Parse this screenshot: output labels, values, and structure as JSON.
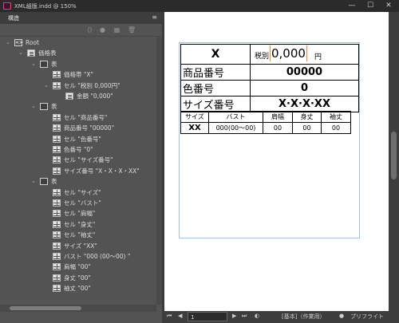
{
  "window": {
    "title": "XML組版.indd @ 150%",
    "minimize": "—",
    "maximize": "☐",
    "close": "✕"
  },
  "panel": {
    "tab_label": "構造",
    "menu_icon": "hamburger-icon",
    "toolbar_icons": [
      "tag-icon",
      "circle-icon",
      "new-element-icon",
      "delete-icon"
    ]
  },
  "tree": [
    {
      "level": 0,
      "twisty": "⌄",
      "icon": "root",
      "label": "Root"
    },
    {
      "level": 1,
      "twisty": "⌄",
      "icon": "doc",
      "label": "価格表"
    },
    {
      "level": 2,
      "twisty": "⌄",
      "icon": "table",
      "label": "表"
    },
    {
      "level": 3,
      "twisty": "",
      "icon": "cell",
      "label": "価格帯 \"X\""
    },
    {
      "level": 3,
      "twisty": "⌄",
      "icon": "cell",
      "label": "セル \"税別 0,000円\""
    },
    {
      "level": 4,
      "twisty": "",
      "icon": "doc",
      "label": "金額 \"0,000\""
    },
    {
      "level": 2,
      "twisty": "⌄",
      "icon": "table",
      "label": "表"
    },
    {
      "level": 3,
      "twisty": "",
      "icon": "cell",
      "label": "セル \"商品番号\""
    },
    {
      "level": 3,
      "twisty": "",
      "icon": "cell",
      "label": "商品番号 \"00000\""
    },
    {
      "level": 3,
      "twisty": "",
      "icon": "cell",
      "label": "セル \"色番号\""
    },
    {
      "level": 3,
      "twisty": "",
      "icon": "cell",
      "label": "色番号 \"0\""
    },
    {
      "level": 3,
      "twisty": "",
      "icon": "cell",
      "label": "セル \"サイズ番号\""
    },
    {
      "level": 3,
      "twisty": "",
      "icon": "cell",
      "label": "サイズ番号 \"X・X・X・XX\""
    },
    {
      "level": 2,
      "twisty": "⌄",
      "icon": "table",
      "label": "表"
    },
    {
      "level": 3,
      "twisty": "",
      "icon": "cell",
      "label": "セル \"サイズ\""
    },
    {
      "level": 3,
      "twisty": "",
      "icon": "cell",
      "label": "セル \"バスト\""
    },
    {
      "level": 3,
      "twisty": "",
      "icon": "cell",
      "label": "セル \"肩幅\""
    },
    {
      "level": 3,
      "twisty": "",
      "icon": "cell",
      "label": "セル \"身丈\""
    },
    {
      "level": 3,
      "twisty": "",
      "icon": "cell",
      "label": "セル \"袖丈\""
    },
    {
      "level": 3,
      "twisty": "",
      "icon": "cell",
      "label": "サイズ \"XX\""
    },
    {
      "level": 3,
      "twisty": "",
      "icon": "cell",
      "label": "バスト \"000 (00～00) \""
    },
    {
      "level": 3,
      "twisty": "",
      "icon": "cell",
      "label": "肩幅 \"00\""
    },
    {
      "level": 3,
      "twisty": "",
      "icon": "cell",
      "label": "身丈 \"00\""
    },
    {
      "level": 3,
      "twisty": "",
      "icon": "cell",
      "label": "袖丈 \"00\""
    }
  ],
  "document": {
    "price_band": "X",
    "price_prefix": "税別",
    "price_amount": "0,000",
    "price_suffix": "円",
    "rows": [
      {
        "label": "商品番号",
        "value": "00000"
      },
      {
        "label": "色番号",
        "value": "0"
      },
      {
        "label": "サイズ番号",
        "value": "X·X·X·XX"
      }
    ],
    "size_headers": [
      "サイズ",
      "バスト",
      "肩幅",
      "身丈",
      "袖丈"
    ],
    "size_values": [
      "XX",
      "000(00～00)",
      "00",
      "00",
      "00"
    ]
  },
  "status": {
    "first_page": "⏮",
    "prev_page": "◀",
    "page": "1",
    "next_page": "▶",
    "last_page": "⏭",
    "master": "[基本]（作業用）",
    "preflight": "プリフライト"
  },
  "colors": {
    "panel_bg": "#535353",
    "frame_guide": "#9ec3e8",
    "tag_highlight": "#f08a2c",
    "app_icon": "#ff2f8c"
  }
}
